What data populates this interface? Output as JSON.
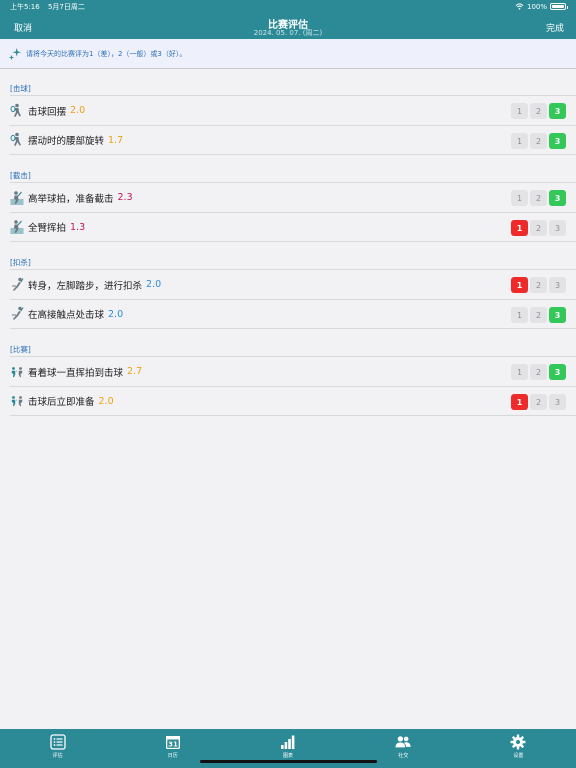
{
  "status": {
    "time": "上午5:16",
    "date": "5月7日周二",
    "battery": "100%"
  },
  "nav": {
    "cancel": "取消",
    "title": "比赛评估",
    "date": "2024. 05. 07. (周二)",
    "done": "完成"
  },
  "banner": {
    "text": "请将今天的比赛评为1（差），2（一般）或3（好）。"
  },
  "sections": [
    {
      "header": "[击球]",
      "items": [
        {
          "label": "击球回摆",
          "score": "2.0",
          "score_color": "orange",
          "rating": 3
        },
        {
          "label": "摆动时的腰部旋转",
          "score": "1.7",
          "score_color": "orange",
          "rating": 3
        }
      ]
    },
    {
      "header": "[截击]",
      "items": [
        {
          "label": "高举球拍，准备截击",
          "score": "2.3",
          "score_color": "magenta",
          "rating": 3
        },
        {
          "label": "全臂挥拍",
          "score": "1.3",
          "score_color": "magenta",
          "rating": 1
        }
      ]
    },
    {
      "header": "[扣杀]",
      "items": [
        {
          "label": "转身，左脚踏步，进行扣杀",
          "score": "2.0",
          "score_color": "blue",
          "rating": 1
        },
        {
          "label": "在高接触点处击球",
          "score": "2.0",
          "score_color": "blue",
          "rating": 3
        }
      ]
    },
    {
      "header": "[比赛]",
      "items": [
        {
          "label": "看着球一直挥拍到击球",
          "score": "2.7",
          "score_color": "orange",
          "rating": 3
        },
        {
          "label": "击球后立即准备",
          "score": "2.0",
          "score_color": "orange",
          "rating": 1
        }
      ]
    }
  ],
  "rating_labels": [
    "1",
    "2",
    "3"
  ],
  "tabs": [
    {
      "label": "评估",
      "icon": "list-icon"
    },
    {
      "label": "日历",
      "icon": "calendar-icon",
      "badge": "31"
    },
    {
      "label": "图表",
      "icon": "chart-icon"
    },
    {
      "label": "社交",
      "icon": "people-icon"
    },
    {
      "label": "设置",
      "icon": "gear-icon"
    }
  ],
  "colors": {
    "accent": "#2b8a96",
    "good": "#34c759",
    "bad": "#ef2a2a"
  }
}
